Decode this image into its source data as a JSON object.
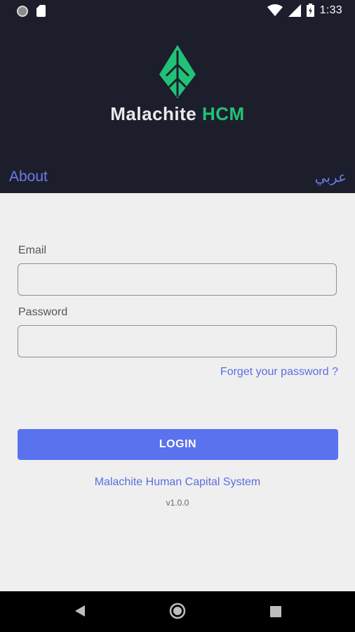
{
  "status_bar": {
    "time": "1:33",
    "icons": [
      "notification-dot-icon",
      "sd-card-icon",
      "wifi-icon",
      "signal-icon",
      "battery-icon"
    ]
  },
  "branding": {
    "name_part1": "Malachite",
    "name_part2": "HCM",
    "accent_color": "#22c178"
  },
  "header": {
    "about_label": "About",
    "language_label": "عربي"
  },
  "form": {
    "email_label": "Email",
    "email_value": "",
    "password_label": "Password",
    "password_value": "",
    "forgot_label": "Forget your password ?",
    "login_label": "LOGIN"
  },
  "footer": {
    "system_name": "Malachite Human Capital System",
    "version": "v1.0.0"
  },
  "nav": {
    "icons": [
      "back-icon",
      "home-icon",
      "recents-icon"
    ]
  },
  "colors": {
    "header_bg": "#1d1e2c",
    "link": "#5b6ee1",
    "button": "#5a72ee"
  }
}
